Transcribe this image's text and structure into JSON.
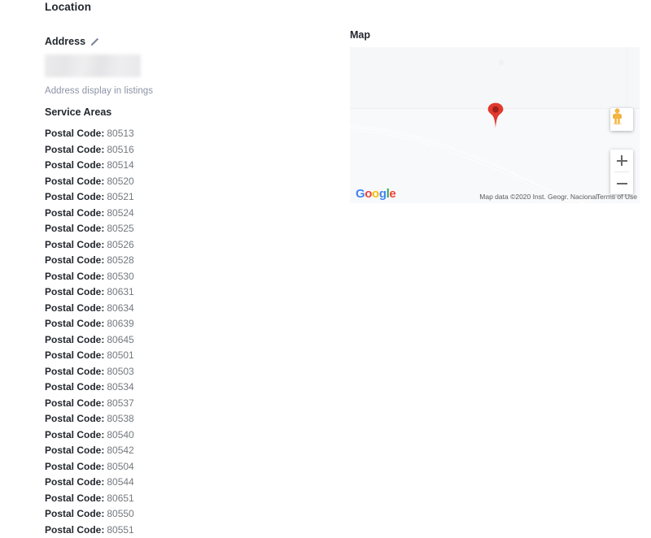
{
  "section": {
    "title": "Location"
  },
  "address": {
    "label": "Address",
    "edit_icon": "pencil-icon",
    "value": "",
    "value_redacted": true,
    "helper_text": "Address display in listings"
  },
  "service_areas": {
    "title": "Service Areas",
    "key_label": "Postal Code:",
    "items": [
      "80513",
      "80516",
      "80514",
      "80520",
      "80521",
      "80524",
      "80525",
      "80526",
      "80528",
      "80530",
      "80631",
      "80634",
      "80639",
      "80645",
      "80501",
      "80503",
      "80534",
      "80537",
      "80538",
      "80540",
      "80542",
      "80504",
      "80544",
      "80651",
      "80550",
      "80551"
    ]
  },
  "map": {
    "label": "Map",
    "marker_icon": "map-marker-icon",
    "pegman_icon": "pegman-street-view-icon",
    "zoom_in_label": "+",
    "zoom_out_label": "−",
    "logo": {
      "letters": [
        {
          "char": "G",
          "color": "#4285F4"
        },
        {
          "char": "o",
          "color": "#EA4335"
        },
        {
          "char": "o",
          "color": "#FBBC05"
        },
        {
          "char": "g",
          "color": "#4285F4"
        },
        {
          "char": "l",
          "color": "#34A853"
        },
        {
          "char": "e",
          "color": "#EA4335"
        }
      ]
    },
    "attribution": "Map data ©2020 Inst. Geogr. Nacional",
    "terms": "Terms of Use"
  },
  "colors": {
    "marker_red": "#E1392D",
    "marker_core": "#9E2019",
    "pegman_yellow": "#F5B642",
    "map_bg": "#f8f9fa",
    "text_dark": "#23282f",
    "text_muted": "#74797f",
    "helper": "#8b93a6"
  }
}
